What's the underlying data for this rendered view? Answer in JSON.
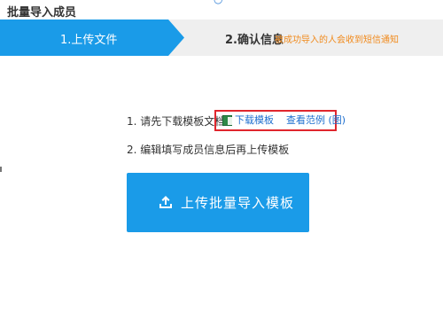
{
  "window": {
    "title": "批量导入成员"
  },
  "steps": [
    {
      "label": "1.上传文件",
      "state": "active"
    },
    {
      "label": "2.确认信息",
      "state": "inactive",
      "note": "被成功导入的人会收到短信通知"
    }
  ],
  "instructions": {
    "line1": "1. 请先下载模板文档",
    "download_link": "下载模板",
    "example_link": "查看范例 (图)",
    "line2": "2. 编辑填写成员信息后再上传模板"
  },
  "upload_button": {
    "label": "上传批量导入模板",
    "icon": "upload-icon"
  },
  "colors": {
    "accent": "#1a9be8",
    "link": "#1e6fcf",
    "note": "#f08a1c",
    "highlight_border": "#e0262d"
  }
}
